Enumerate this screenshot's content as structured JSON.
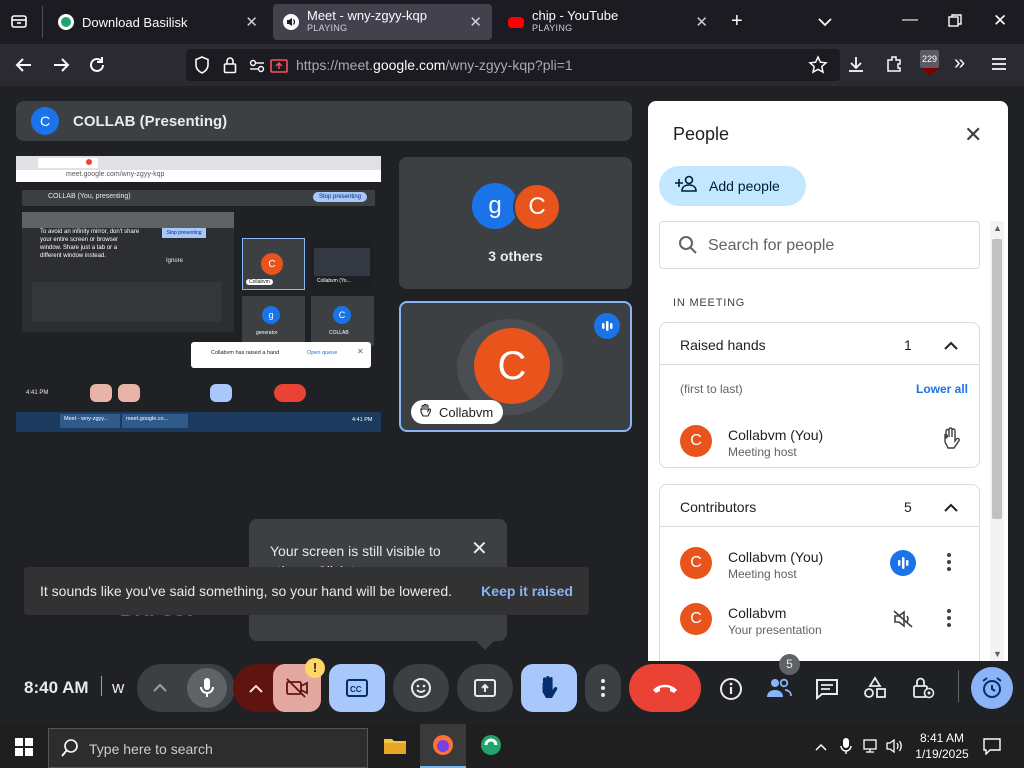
{
  "browser": {
    "tabs": [
      {
        "title": "Download Basilisk",
        "subtitle": ""
      },
      {
        "title": "Meet - wny-zgyy-kqp",
        "subtitle": "PLAYING"
      },
      {
        "title": "chip - YouTube",
        "subtitle": "PLAYING"
      }
    ],
    "new_tab": "+",
    "url_prefix": "https://meet.",
    "url_domain": "google.com",
    "url_path": "/wny-zgyy-kqp?pli=1",
    "downloads_badge": "229"
  },
  "meet": {
    "presenting": {
      "avatar": "C",
      "label": "COLLAB (Presenting)"
    },
    "screenshare": {
      "url": "meet.google.com/wny-zgyy-kqp",
      "presenting_label": "COLLAB (You, presenting)",
      "stop_presenting": "Stop presenting",
      "stop_small": "Stop presenting",
      "ignore": "Ignore",
      "mirror_warning": "To avoid an infinity mirror, don't share your entire screen or browser window. Share just a tab or a different window instead.",
      "tile_labels": [
        "Collabvm",
        "Collabvm (Yo...",
        "generator",
        "COLLAB"
      ],
      "raised_hand_toast": "Collabvm has raised a hand",
      "open_queue": "Open queue",
      "time": "4:41 PM",
      "task_time": "4:41 PM",
      "task_tabs": [
        "Meet - wny-zgyy...",
        "meet.google.co..."
      ]
    },
    "others_tile": {
      "avatars": [
        "g",
        "C"
      ],
      "label": "3 others"
    },
    "self_tile": {
      "avatar": "C",
      "name": "Collabvm"
    },
    "visibility_popup": {
      "text": "Your screen is still visible to others. Click to resume.",
      "partial_under": "DRFoot"
    },
    "snackbar": {
      "message": "It sounds like you've said something, so your hand will be lowered.",
      "action": "Keep it raised"
    }
  },
  "people_panel": {
    "title": "People",
    "add_people": "Add people",
    "search_placeholder": "Search for people",
    "section_label": "IN MEETING",
    "raised_hands": {
      "label": "Raised hands",
      "count": "1",
      "order_note": "(first to last)",
      "lower_all": "Lower all",
      "people": [
        {
          "avatar": "C",
          "name": "Collabvm (You)",
          "role": "Meeting host"
        }
      ]
    },
    "contributors": {
      "label": "Contributors",
      "count": "5",
      "people": [
        {
          "avatar": "C",
          "name": "Collabvm (You)",
          "role": "Meeting host"
        },
        {
          "avatar": "C",
          "name": "Collabvm",
          "role": "Your presentation"
        }
      ]
    }
  },
  "controls": {
    "time": "8:40 AM",
    "meeting_code_partial": "w",
    "people_badge": "5",
    "warning_badge": "!"
  },
  "taskbar": {
    "search_placeholder": "Type here to search",
    "time": "8:41 AM",
    "date": "1/19/2025"
  },
  "colors": {
    "meet_bg": "#202124",
    "accent_blue": "#1a73e8",
    "avatar_orange": "#e8541c",
    "leave_red": "#ea4335",
    "raise_hand_active": "#a8c7fa"
  }
}
